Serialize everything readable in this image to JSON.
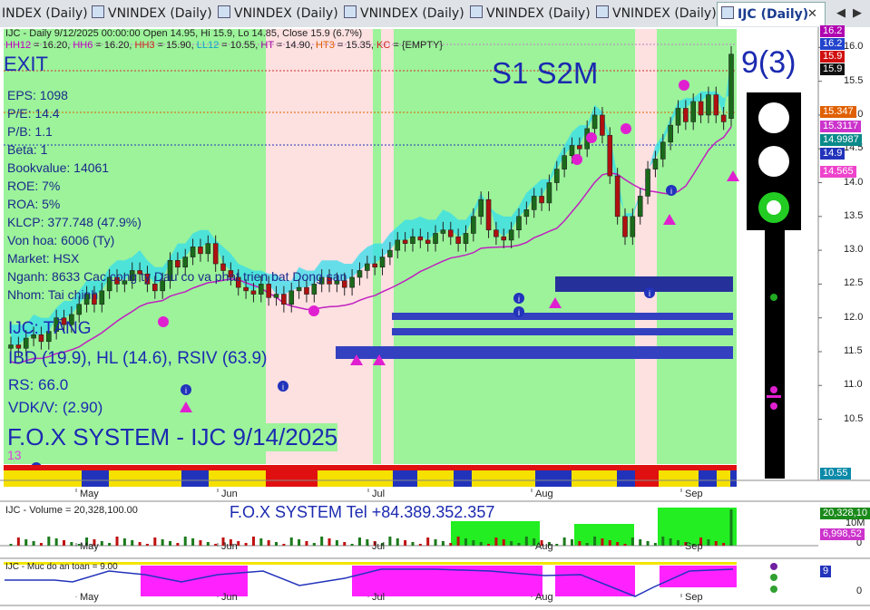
{
  "tabs": [
    {
      "label": "INDEX (Daily)"
    },
    {
      "label": "VNINDEX (Daily)"
    },
    {
      "label": "VNINDEX (Daily)"
    },
    {
      "label": "VNINDEX (Daily)"
    },
    {
      "label": "VNINDEX (Daily)"
    },
    {
      "label": "VNINDEX (Daily)"
    },
    {
      "label": "IJC (Daily)",
      "active": true
    }
  ],
  "header_line": "IJC - Daily 9/12/2025 00:00:00 Open 14.95, Hi 15.9, Lo 14.85, Close 15.9 (6.7%)",
  "header_line2": [
    {
      "t": "HH12",
      "c": "#c000c0"
    },
    {
      "t": " = 16.20, ",
      "c": "#222"
    },
    {
      "t": "HH6",
      "c": "#c000c0"
    },
    {
      "t": " = 16.20, ",
      "c": "#222"
    },
    {
      "t": "HH3",
      "c": "#d02020"
    },
    {
      "t": " = 15.90, ",
      "c": "#222"
    },
    {
      "t": "LL12",
      "c": "#10a0d0"
    },
    {
      "t": " = 10.55, ",
      "c": "#222"
    },
    {
      "t": "HT",
      "c": "#a000a0"
    },
    {
      "t": "  = 14.90, ",
      "c": "#222"
    },
    {
      "t": "HT3",
      "c": "#e06000"
    },
    {
      "t": " = 15.35, ",
      "c": "#222"
    },
    {
      "t": "KC",
      "c": "#d02020"
    },
    {
      "t": " = {EMPTY}",
      "c": "#222"
    }
  ],
  "exit_label": "EXIT",
  "stats": [
    "EPS: 1098",
    "P/E: 14.4",
    "P/B: 1.1",
    "Beta: 1",
    "Bookvalue: 14061",
    "ROE: 7%",
    "ROA: 5%",
    "KLCP: 377.748 (47.9%)",
    "Von hoa: 6006 (Ty)",
    "Market: HSX",
    "Nganh: 8633 Cac cong ty Dau co va phat trien bat Dong san",
    "Nhom: Tai chinh"
  ],
  "signal_label": "IJC: TĂNG",
  "ibd_label": "IBD (19.9), HL (14.6), RSIV (63.9)",
  "rs_label": "RS: 66.0",
  "vdk_label": "VDK/V:  (2.90)",
  "fox_title": "F.O.X SYSTEM - IJC 9/14/2025",
  "small_num": "13",
  "s1s2m_label": "S1  S2M",
  "score_label": "9(3)",
  "fox_tel": "F.O.X SYSTEM Tel +84.389.352.357",
  "price_axis": [
    "16.0",
    "15.5",
    "15.0",
    "14.5",
    "14.0",
    "13.5",
    "13.0",
    "12.5",
    "12.0",
    "11.5",
    "11.0",
    "10.5"
  ],
  "price_tags": [
    {
      "label": "16.2",
      "bg": "#b000b0"
    },
    {
      "label": "16.2",
      "bg": "#2244cc"
    },
    {
      "label": "15.9",
      "bg": "#d01010"
    },
    {
      "label": "15.9",
      "bg": "#111111"
    },
    {
      "label": "15.347",
      "bg": "#e06000"
    },
    {
      "label": "15.3117",
      "bg": "#cc33cc"
    },
    {
      "label": "14.9987",
      "bg": "#0a8a8a"
    },
    {
      "label": "14.9",
      "bg": "#2233bb"
    },
    {
      "label": "14.565",
      "bg": "#ee44cc"
    },
    {
      "label": "10.55",
      "bg": "#0a8aa8"
    }
  ],
  "months": [
    "May",
    "Jun",
    "Jul",
    "Aug",
    "Sep"
  ],
  "volume_label": "IJC - Volume = 20,328,100.00",
  "volume_axis": [
    "10M",
    "0"
  ],
  "volume_tags": [
    {
      "label": "20,328,10",
      "bg": "#1a8a1a"
    },
    {
      "label": "6,998,52",
      "bg": "#cc33cc"
    }
  ],
  "safety_label": "IJC - Muc do an toan = 9.00",
  "safety_axis": [
    "0"
  ],
  "safety_tag": {
    "label": "9",
    "bg": "#2233bb"
  },
  "chart_data": {
    "type": "candlestick",
    "symbol": "IJC",
    "interval": "Daily",
    "last_bar": {
      "date": "9/12/2025",
      "open": 14.95,
      "high": 15.9,
      "low": 14.85,
      "close": 15.9,
      "change_pct": 6.7
    },
    "ylim": [
      10.4,
      16.3
    ],
    "months": [
      "May",
      "Jun",
      "Jul",
      "Aug",
      "Sep"
    ],
    "closes": [
      11.6,
      11.55,
      11.7,
      11.75,
      11.65,
      11.8,
      12.0,
      11.9,
      12.05,
      12.2,
      12.35,
      12.2,
      12.4,
      12.6,
      12.5,
      12.55,
      12.7,
      12.65,
      12.5,
      12.4,
      12.55,
      12.85,
      12.75,
      12.9,
      13.05,
      12.95,
      13.1,
      12.8,
      12.7,
      12.6,
      12.45,
      12.4,
      12.35,
      12.5,
      12.3,
      12.35,
      12.2,
      12.4,
      12.45,
      12.35,
      12.5,
      12.6,
      12.5,
      12.55,
      12.45,
      12.6,
      12.7,
      12.8,
      12.75,
      12.9,
      13.0,
      13.15,
      13.1,
      13.2,
      13.15,
      13.1,
      13.25,
      13.3,
      13.2,
      13.1,
      13.25,
      13.5,
      13.75,
      13.3,
      13.2,
      13.15,
      13.3,
      13.5,
      13.6,
      13.8,
      13.7,
      14.0,
      14.2,
      14.4,
      14.55,
      14.5,
      14.8,
      15.0,
      14.7,
      14.1,
      13.5,
      13.2,
      13.5,
      13.8,
      14.2,
      14.35,
      14.6,
      14.85,
      15.1,
      14.9,
      15.2,
      15.0,
      15.3,
      15.0,
      14.9,
      15.9
    ],
    "volume": {
      "last": 20328100,
      "ma": 6998520
    },
    "safety_level": 9
  }
}
